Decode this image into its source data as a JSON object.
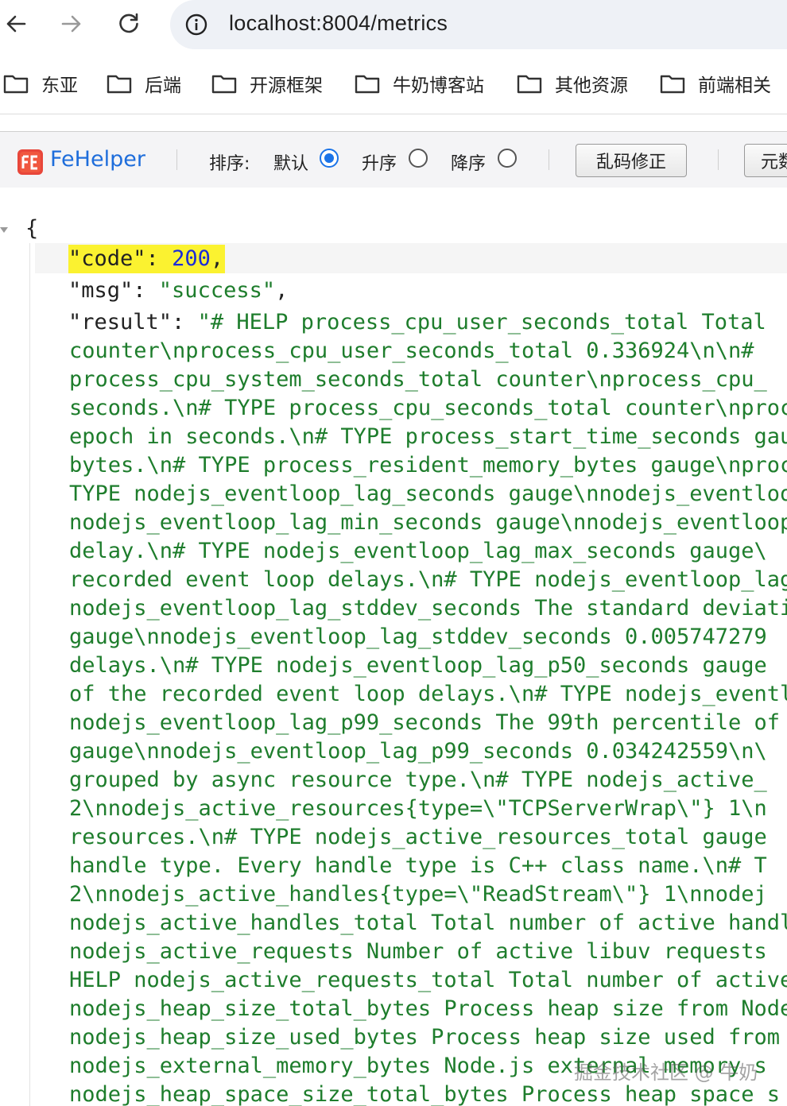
{
  "browser": {
    "url": "localhost:8004/metrics"
  },
  "bookmarks": [
    "东亚",
    "后端",
    "开源框架",
    "牛奶博客站",
    "其他资源",
    "前端相关"
  ],
  "fehelper": {
    "brand": "FeHelper",
    "sort_label": "排序:",
    "sort_options": [
      {
        "label": "默认",
        "selected": true
      },
      {
        "label": "升序",
        "selected": false
      },
      {
        "label": "降序",
        "selected": false
      }
    ],
    "fix_encoding_button": "乱码修正",
    "clipped_button": "元数"
  },
  "json_view": {
    "open_brace": "{",
    "code_key": "\"code\"",
    "code_value": "200",
    "msg_key": "\"msg\"",
    "msg_value": "\"success\"",
    "result_key": "\"result\"",
    "result_first": "\"# HELP process_cpu_user_seconds_total Total",
    "result_lines": [
      "counter\\nprocess_cpu_user_seconds_total 0.336924\\n\\n#",
      "process_cpu_system_seconds_total counter\\nprocess_cpu_",
      "seconds.\\n# TYPE process_cpu_seconds_total counter\\nprocess",
      "epoch in seconds.\\n# TYPE process_start_time_seconds gauge",
      "bytes.\\n# TYPE process_resident_memory_bytes gauge\\nprocess",
      "TYPE nodejs_eventloop_lag_seconds gauge\\nnodejs_eventloop",
      "nodejs_eventloop_lag_min_seconds gauge\\nnodejs_eventloop",
      "delay.\\n# TYPE nodejs_eventloop_lag_max_seconds gauge\\",
      "recorded event loop delays.\\n# TYPE nodejs_eventloop_lag",
      "nodejs_eventloop_lag_stddev_seconds The standard deviation",
      "gauge\\nnodejs_eventloop_lag_stddev_seconds 0.005747279",
      "delays.\\n# TYPE nodejs_eventloop_lag_p50_seconds gauge",
      "of the recorded event loop delays.\\n# TYPE nodejs_eventloop",
      "nodejs_eventloop_lag_p99_seconds The 99th percentile of",
      "gauge\\nnodejs_eventloop_lag_p99_seconds 0.034242559\\n\\",
      "grouped by async resource type.\\n# TYPE nodejs_active_",
      "2\\nnodejs_active_resources{type=\\\"TCPServerWrap\\\"} 1\\n",
      "resources.\\n# TYPE nodejs_active_resources_total gauge",
      "handle type. Every handle type is C++ class name.\\n# T",
      "2\\nnodejs_active_handles{type=\\\"ReadStream\\\"} 1\\nnodej",
      "nodejs_active_handles_total Total number of active handles",
      "nodejs_active_requests Number of active libuv requests",
      "HELP nodejs_active_requests_total Total number of active",
      "nodejs_heap_size_total_bytes Process heap size from Node",
      "nodejs_heap_size_used_bytes Process heap size used from",
      "nodejs_external_memory_bytes Node.js external memory s",
      "nodejs_heap_space_size_total_bytes Process heap space s"
    ]
  },
  "watermark": "掘金技术社区 @ 牛奶"
}
